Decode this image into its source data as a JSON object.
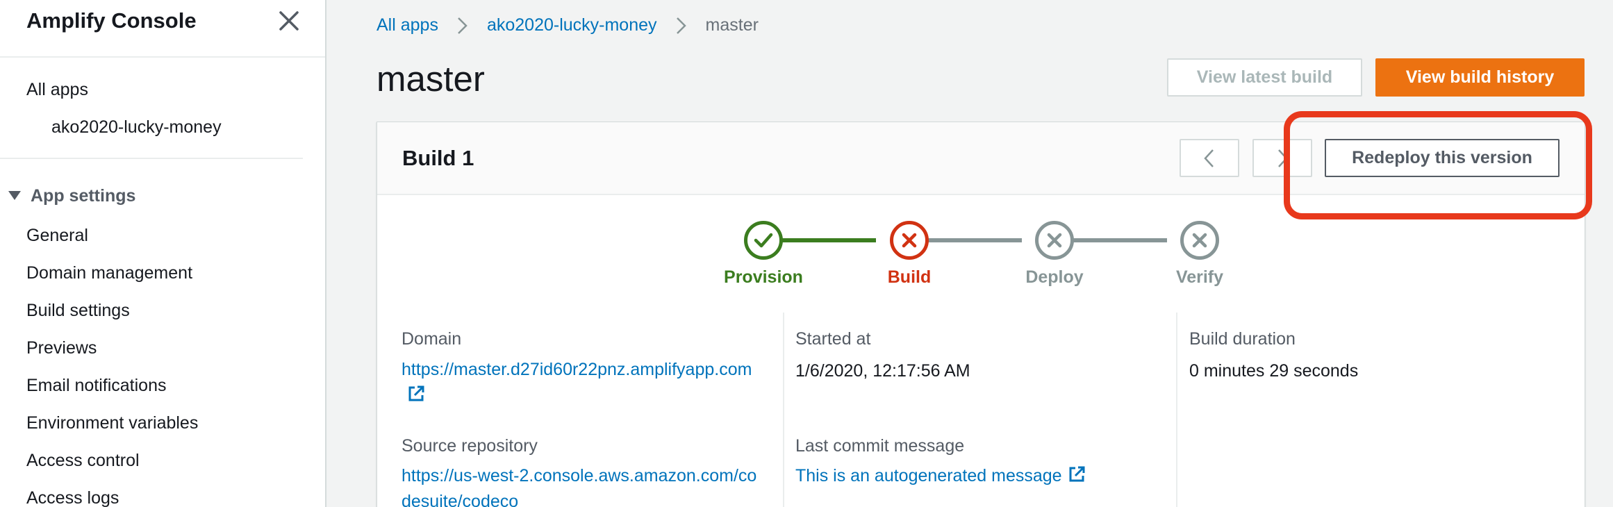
{
  "sidebar": {
    "title": "Amplify Console",
    "close_icon": "close-icon",
    "nav": {
      "all_apps": "All apps",
      "app_name": "ako2020-lucky-money"
    },
    "section_title": "App settings",
    "items": [
      {
        "label": "General"
      },
      {
        "label": "Domain management"
      },
      {
        "label": "Build settings"
      },
      {
        "label": "Previews"
      },
      {
        "label": "Email notifications"
      },
      {
        "label": "Environment variables"
      },
      {
        "label": "Access control"
      },
      {
        "label": "Access logs"
      }
    ]
  },
  "breadcrumb": {
    "items": [
      "All apps",
      "ako2020-lucky-money",
      "master"
    ]
  },
  "page": {
    "title": "master",
    "view_latest_build": "View latest build",
    "view_build_history": "View build history"
  },
  "build": {
    "title": "Build 1",
    "redeploy_label": "Redeploy this version",
    "steps": [
      {
        "label": "Provision",
        "status": "success",
        "icon": "check-icon"
      },
      {
        "label": "Build",
        "status": "failed",
        "icon": "x-icon"
      },
      {
        "label": "Deploy",
        "status": "skipped",
        "icon": "x-icon"
      },
      {
        "label": "Verify",
        "status": "skipped",
        "icon": "x-icon"
      }
    ],
    "details": {
      "domain_label": "Domain",
      "domain_value": "https://master.d27id60r22pnz.amplifyapp.com",
      "source_label": "Source repository",
      "source_value": "https://us-west-2.console.aws.amazon.com/codesuite/codeco",
      "started_label": "Started at",
      "started_value": "1/6/2020, 12:17:56 AM",
      "commit_label": "Last commit message",
      "commit_value": "This is an autogenerated message",
      "duration_label": "Build duration",
      "duration_value": "0 minutes 29 seconds"
    }
  },
  "colors": {
    "link": "#0073bb",
    "primary": "#ec7211",
    "success": "#3b7d1f",
    "error": "#d13212",
    "neutral": "#879596",
    "annotation": "#e8391c"
  }
}
